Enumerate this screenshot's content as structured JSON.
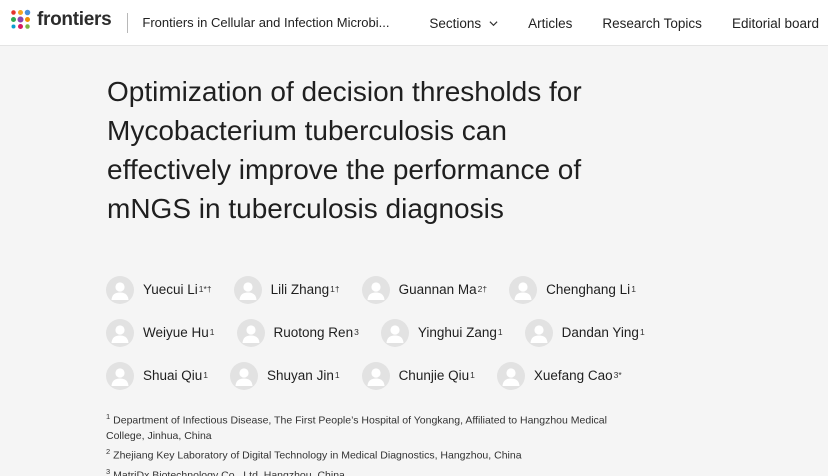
{
  "header": {
    "logo_text": "frontiers",
    "journal": "Frontiers in Cellular and Infection Microbi...",
    "nav": [
      {
        "label": "Sections",
        "has_dropdown": true
      },
      {
        "label": "Articles",
        "has_dropdown": false
      },
      {
        "label": "Research Topics",
        "has_dropdown": false
      },
      {
        "label": "Editorial board",
        "has_dropdown": false
      }
    ]
  },
  "article": {
    "title_lines": [
      "Optimization of decision thresholds for",
      "Mycobacterium tuberculosis can",
      "effectively improve the performance of",
      "mNGS in tuberculosis diagnosis"
    ],
    "author_rows": [
      [
        {
          "name": "Yuecui Li",
          "sup": "1*†"
        },
        {
          "name": "Lili Zhang",
          "sup": "1†"
        },
        {
          "name": "Guannan Ma",
          "sup": "2†"
        },
        {
          "name": "Chenghang Li",
          "sup": "1"
        }
      ],
      [
        {
          "name": "Weiyue Hu",
          "sup": "1"
        },
        {
          "name": "Ruotong Ren",
          "sup": "3"
        },
        {
          "name": "Yinghui Zang",
          "sup": "1"
        },
        {
          "name": "Dandan Ying",
          "sup": "1"
        }
      ],
      [
        {
          "name": "Shuai Qiu",
          "sup": "1"
        },
        {
          "name": "Shuyan Jin",
          "sup": "1"
        },
        {
          "name": "Chunjie Qiu",
          "sup": "1"
        },
        {
          "name": "Xuefang Cao",
          "sup": "3*"
        }
      ]
    ],
    "affiliations": [
      {
        "num": "1",
        "lines": [
          "Department of Infectious Disease, The First People’s Hospital of Yongkang, Affiliated to Hangzhou Medical",
          "College, Jinhua, China"
        ]
      },
      {
        "num": "2",
        "lines": [
          "Zhejiang Key Laboratory of Digital Technology in Medical Diagnostics, Hangzhou, China"
        ]
      },
      {
        "num": "3",
        "lines": [
          "MatriDx Biotechnology Co., Ltd, Hangzhou, China"
        ]
      }
    ]
  },
  "colors": {
    "background": "#f5f5f5",
    "header_bg": "#ffffff",
    "avatar": "#e2e2e2",
    "logo_dots": [
      "#e5342a",
      "#f5a623",
      "#4a90d9",
      "#2fa84f",
      "#8e44ad",
      "#f08c00",
      "#0a9fcf",
      "#d81b60",
      "#7cb342"
    ]
  },
  "icons": {
    "logo": "frontiers-logo-icon",
    "dropdown": "chevron-down-icon",
    "avatar": "user-avatar-icon"
  }
}
